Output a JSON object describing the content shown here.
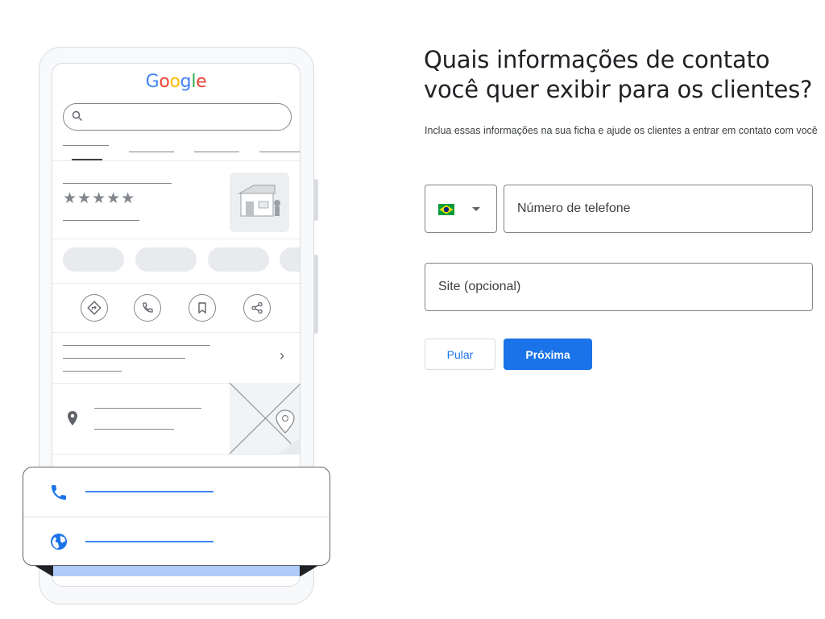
{
  "illustration": {
    "logo_text": "Google",
    "logo_colors": [
      "#4285f4",
      "#ea4335",
      "#fbbc05",
      "#4285f4",
      "#34a853",
      "#ea4335"
    ],
    "stars": "★★★★★",
    "chevron": "›",
    "icons": [
      "search-icon",
      "directions-icon",
      "phone-icon",
      "bookmark-icon",
      "share-icon",
      "location-pin-icon",
      "storefront-icon",
      "map-pin-icon",
      "phone-icon",
      "globe-icon"
    ],
    "accent_color": "#4285f4"
  },
  "form": {
    "title": "Quais informações de contato você quer exibir para os clientes?",
    "subtitle": "Inclua essas informações na sua ficha e ajude os clientes a entrar em contato com você",
    "country_flag": "brazil-flag-icon",
    "phone_placeholder": "Número de telefone",
    "site_placeholder": "Site (opcional)",
    "skip_label": "Pular",
    "next_label": "Próxima",
    "primary_color": "#1a73e8"
  }
}
